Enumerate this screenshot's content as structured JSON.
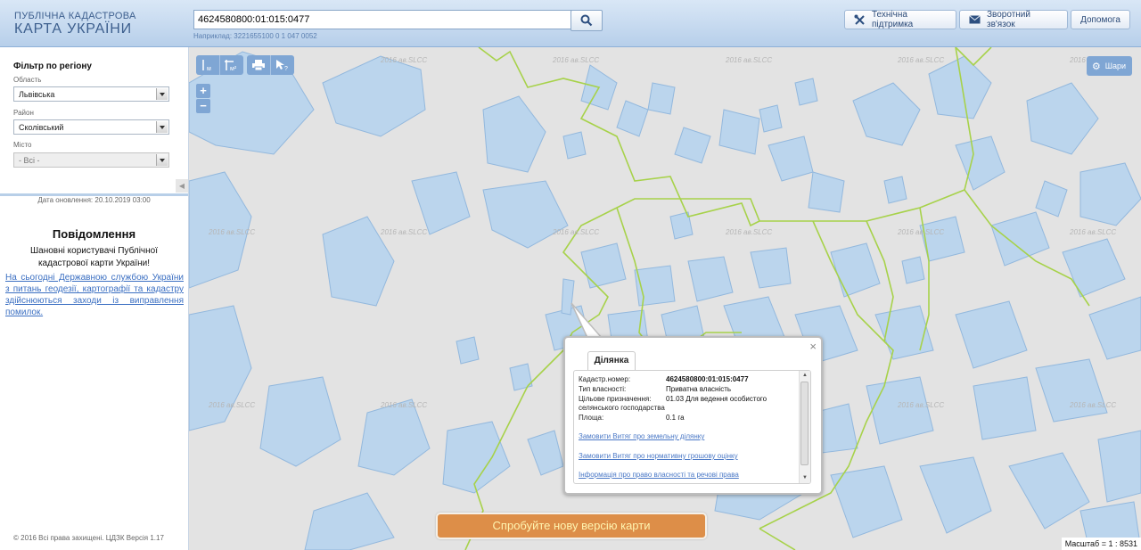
{
  "header": {
    "logo_line1": "ПУБЛІЧНА КАДАСТРОВА",
    "logo_line2": "КАРТА УКРАЇНИ",
    "search_value": "4624580800:01:015:0477",
    "search_example": "Наприклад: 3221655100 0 1 047 0052",
    "buttons": {
      "support": "Технічна підтримка",
      "feedback": "Зворотний зв'язок",
      "help": "Допомога"
    }
  },
  "sidebar": {
    "filter_title": "Фільтр по регіону",
    "region_label": "Область",
    "region_value": "Львівська",
    "district_label": "Район",
    "district_value": "Сколівський",
    "city_label": "Місто",
    "city_value": "- Всі -",
    "update_date": "Дата оновлення: 20.10.2019 03:00",
    "notice_title": "Повідомлення",
    "notice_text": "Шановні користувачі Публічної кадастрової карти України!",
    "notice_link": "На сьогодні Державною службою України з питань геодезії, картографії та кадастру здійснюються заходи із виправлення помилок.",
    "copyright": "© 2016 Всі права захищені. ЦДЗК Версія 1.17"
  },
  "map": {
    "layers_label": "Шари",
    "zoom_in": "+",
    "zoom_out": "−",
    "watermark": "2016 ав.SLCC",
    "new_version": "Спробуйте нову версію карти",
    "scale": "Масштаб = 1 : 8531",
    "tools": {
      "distance_label": "м",
      "area_label": "м²"
    }
  },
  "popup": {
    "tab": "Ділянка",
    "close": "×",
    "rows": {
      "cadastral_label": "Кадастр.номер:",
      "cadastral_value": "4624580800:01:015:0477",
      "ownership_label": "Тип власності:",
      "ownership_value": "Приватна власність",
      "purpose_label": "Цільове призначення:",
      "purpose_value": "01.03 Для ведення особистого",
      "purpose_cont": "селянського господарства",
      "area_label": "Площа:",
      "area_value": "0.1 га"
    },
    "links": {
      "extract": "Замовити Витяг про земельну ділянку",
      "valuation": "Замовити Витяг про нормативну грошову оцінку",
      "rights": "Інформація про право власності та речові права"
    }
  },
  "colors": {
    "parcel_fill": "#b9d5ee",
    "parcel_stroke": "#8fb6dd",
    "boundary": "#a7d24a",
    "accent": "#7fa6d4"
  }
}
